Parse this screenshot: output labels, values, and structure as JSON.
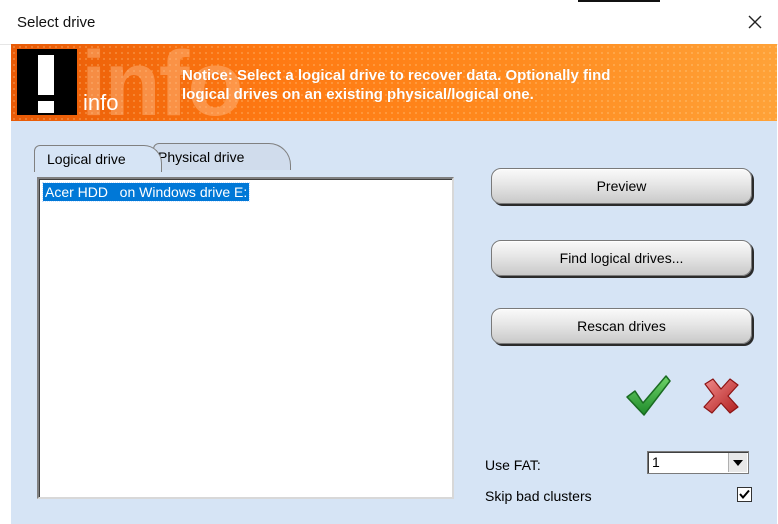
{
  "window": {
    "title": "Select drive",
    "close_icon": "close-icon"
  },
  "banner": {
    "badge_icon": "exclamation-icon",
    "watermark_text": "info",
    "label": "info",
    "notice_line1": "Notice: Select a logical drive to recover data. Optionally find",
    "notice_line2": "logical drives on an existing physical/logical one.",
    "colors": {
      "start": "#e85a06",
      "end": "#ffa238"
    }
  },
  "tabs": [
    {
      "label": "Logical drive",
      "selected": true
    },
    {
      "label": "Physical drive",
      "selected": false
    }
  ],
  "drive_list": {
    "items": [
      {
        "label": "Acer HDD   on Windows drive E:",
        "selected": true
      }
    ]
  },
  "buttons": {
    "preview": "Preview",
    "find_logical": "Find logical drives...",
    "rescan": "Rescan drives"
  },
  "actions": {
    "ok_icon": "checkmark-icon",
    "cancel_icon": "red-x-icon"
  },
  "options": {
    "use_fat_label": "Use FAT:",
    "use_fat_value": "1",
    "skip_bad_label": "Skip bad clusters",
    "skip_bad_checked": true
  },
  "colors": {
    "body_background": "#d6e4f5",
    "selection": "#0078d7"
  }
}
